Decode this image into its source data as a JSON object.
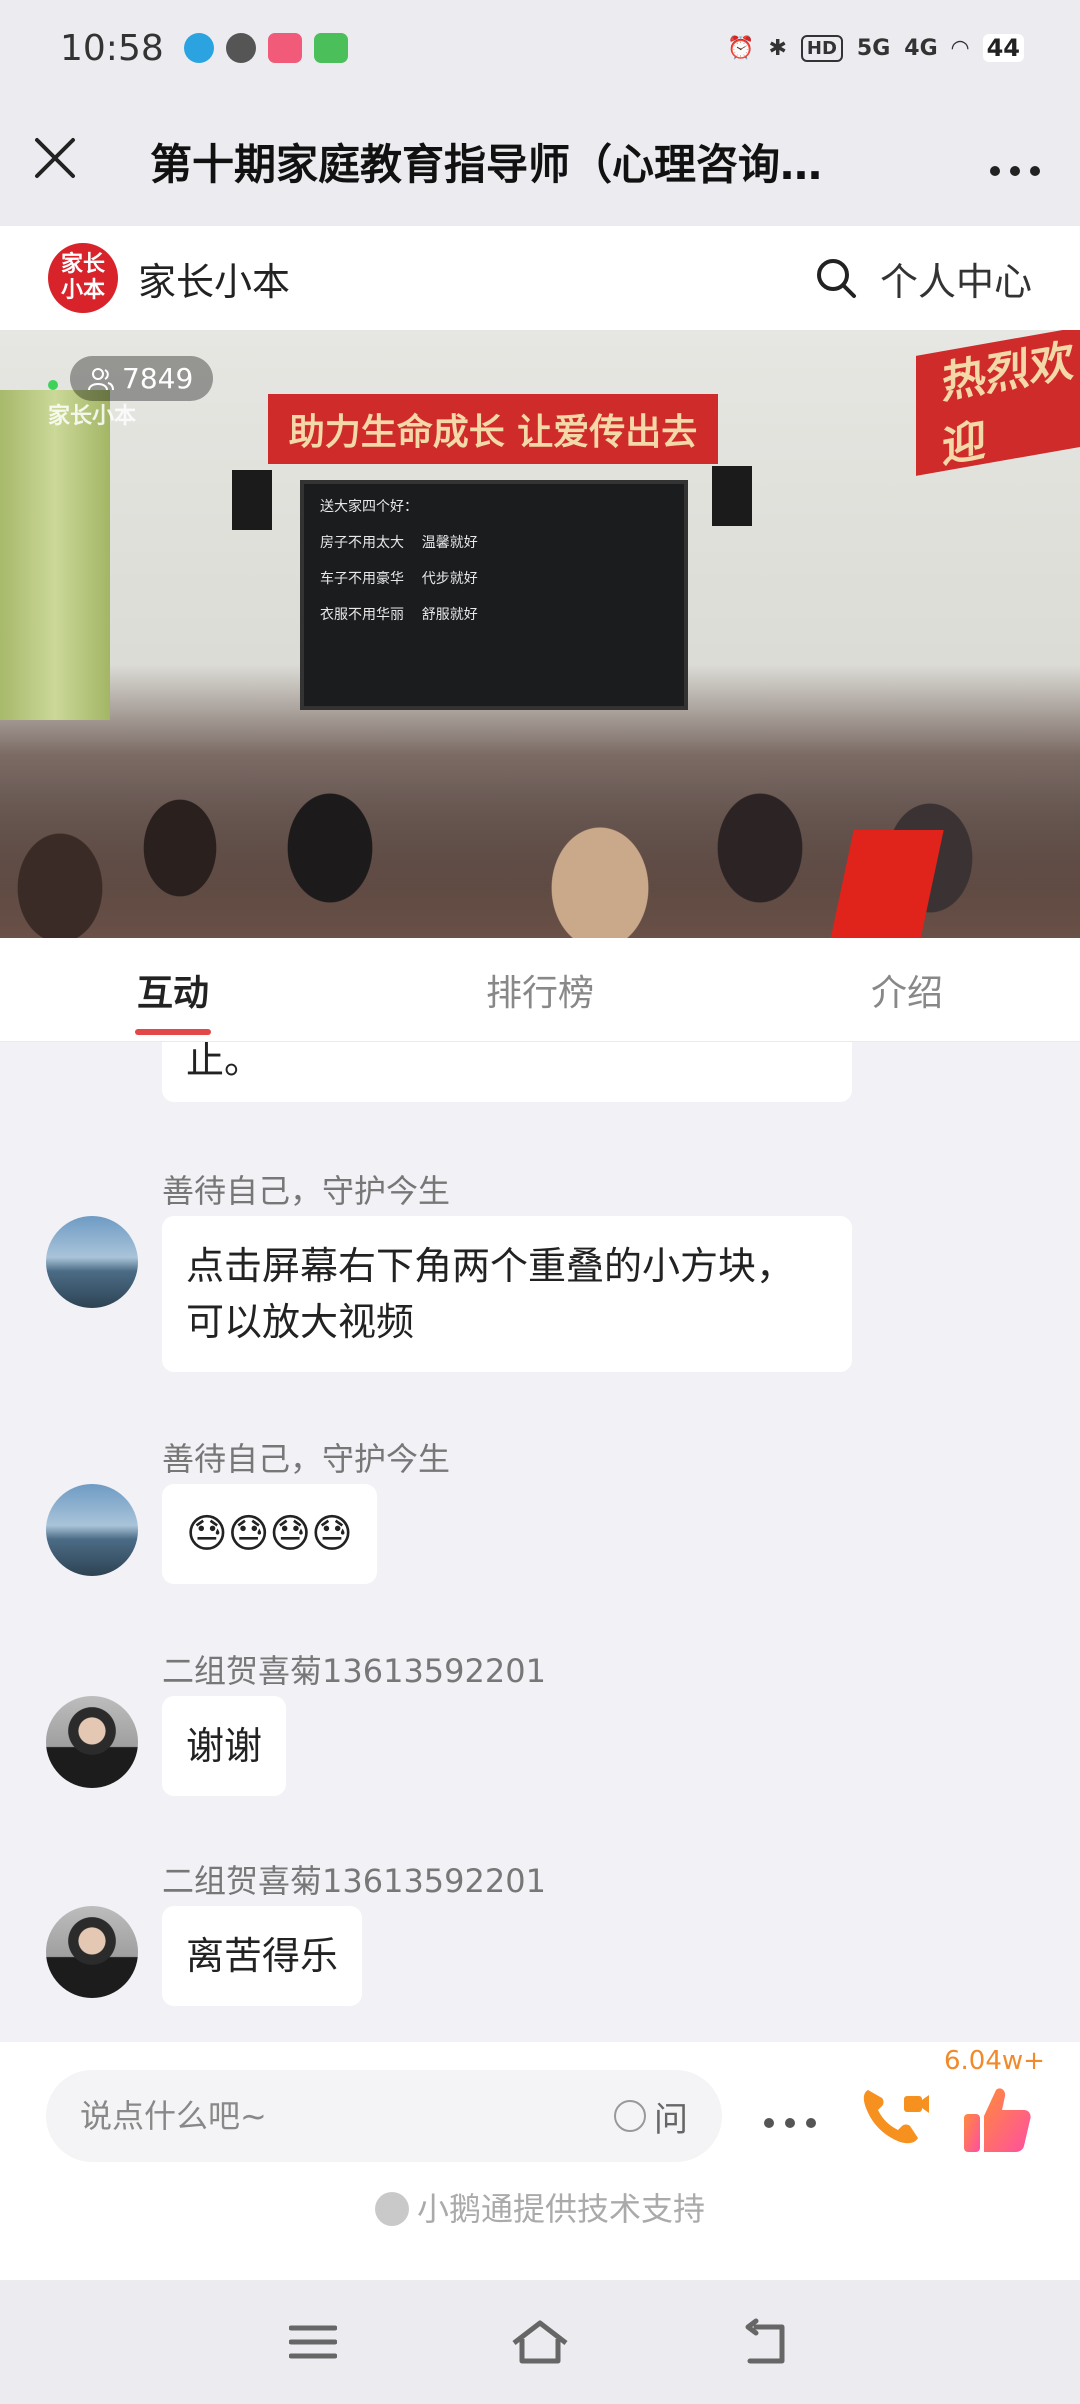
{
  "status_bar": {
    "time": "10:58",
    "network1": "5G",
    "network2": "4G",
    "hd": "HD",
    "battery": "44"
  },
  "title_bar": {
    "title": "第十期家庭教育指导师（心理咨询…",
    "close_icon": "close-icon",
    "more_icon": "more-icon"
  },
  "brand_bar": {
    "logo_text": "家长小本",
    "brand_name": "家长小本",
    "personal_center": "个人中心"
  },
  "video": {
    "viewer_count": "7849",
    "watermark": "家长小本",
    "banner_left": "助力生命成长 让爱传出去",
    "banner_right": "热烈欢迎",
    "screen_lines": [
      "送大家四个好：",
      "房子不用太大    温馨就好",
      "车子不用豪华    代步就好",
      "衣服不用华丽    舒服就好"
    ]
  },
  "tabs": [
    {
      "label": "互动",
      "active": true
    },
    {
      "label": "排行榜",
      "active": false
    },
    {
      "label": "介绍",
      "active": false
    }
  ],
  "messages": [
    {
      "name": "",
      "text": "止。"
    },
    {
      "name": "善待自己，守护今生",
      "text": "点击屏幕右下角两个重叠的小方块，可以放大视频"
    },
    {
      "name": "善待自己，守护今生",
      "text": "😓😓😓😓"
    },
    {
      "name": "二组贺喜菊13613592201",
      "text": "谢谢"
    },
    {
      "name": "二组贺喜菊13613592201",
      "text": "离苦得乐"
    }
  ],
  "input_bar": {
    "placeholder": "说点什么吧~",
    "ask_label": "问",
    "like_count": "6.04w+",
    "support_text": "小鹅通提供技术支持"
  },
  "colors": {
    "accent_red": "#e24848",
    "brand_red": "#d8232a",
    "like_orange": "#f08a2a"
  }
}
